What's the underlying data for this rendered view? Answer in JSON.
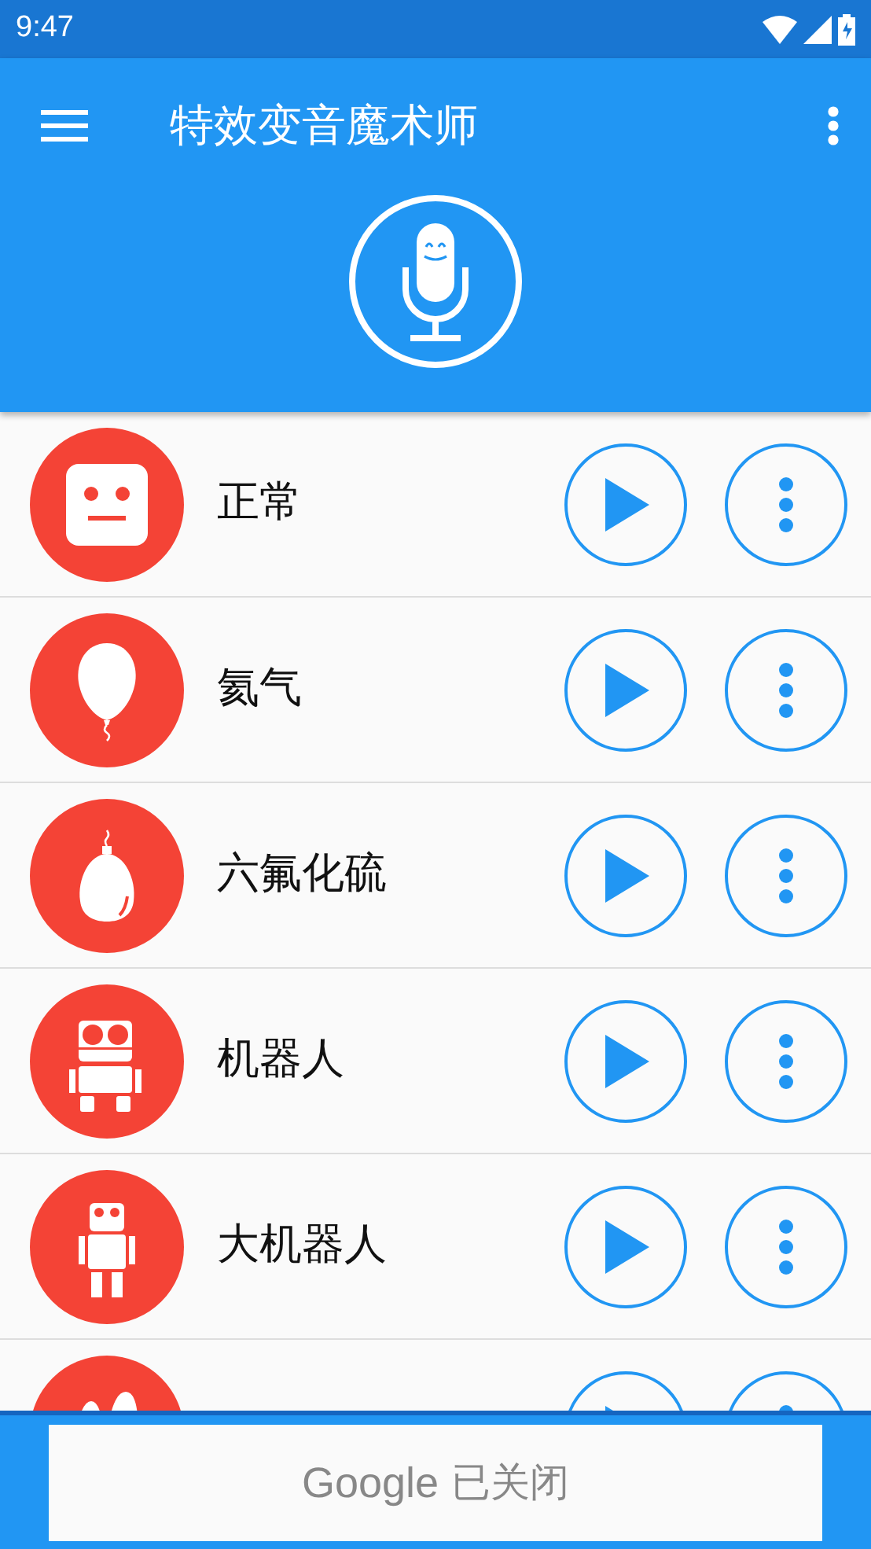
{
  "status_bar": {
    "time": "9:47"
  },
  "app_bar": {
    "title": "特效变音魔术师"
  },
  "effects": [
    {
      "kind": "face",
      "name": "正常"
    },
    {
      "kind": "balloon",
      "name": "氦气"
    },
    {
      "kind": "egg",
      "name": "六氟化硫"
    },
    {
      "kind": "robot",
      "name": "机器人"
    },
    {
      "kind": "tall-robot",
      "name": "大机器人"
    },
    {
      "kind": "ears"
    }
  ],
  "ad": {
    "brand": "Google",
    "text": "已关闭"
  }
}
